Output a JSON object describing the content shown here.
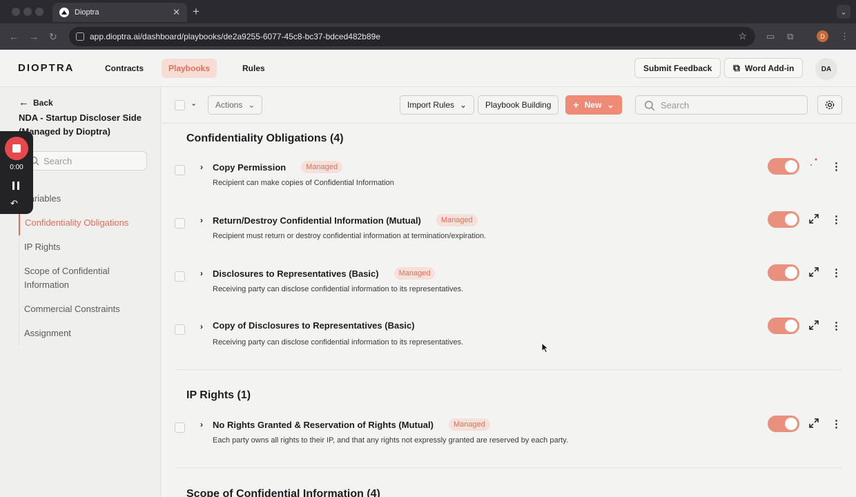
{
  "browser": {
    "tab_title": "Dioptra",
    "url": "app.dioptra.ai/dashboard/playbooks/de2a9255-6077-45c8-bc37-bdced482b89e",
    "profile_initial": "D"
  },
  "nav": {
    "logo": "DIOPTRA",
    "links": [
      "Contracts",
      "Playbooks",
      "Rules"
    ],
    "active": "Playbooks",
    "submit_feedback": "Submit Feedback",
    "word_addin": "Word Add-in",
    "avatar": "DA"
  },
  "sidebar": {
    "back": "Back",
    "title": "NDA - Startup Discloser Side (Managed by Dioptra)",
    "search_placeholder": "Search",
    "items": [
      "Variables",
      "Confidentiality Obligations",
      "IP Rights",
      "Scope of Confidential Information",
      "Commercial Constraints",
      "Assignment"
    ],
    "active": "Confidentiality Obligations"
  },
  "recorder": {
    "time": "0:00"
  },
  "toolbar": {
    "actions": "Actions",
    "import_rules": "Import Rules",
    "playbook_building": "Playbook Building",
    "new": "New",
    "search_placeholder": "Search"
  },
  "sections": [
    {
      "title": "Confidentiality Obligations (4)",
      "rules": [
        {
          "name": "Copy Permission",
          "badge": "Managed",
          "desc": "Recipient can make copies of Confidential Information"
        },
        {
          "name": "Return/Destroy Confidential Information (Mutual)",
          "badge": "Managed",
          "desc": "Recipient must return or destroy confidential information at termination/expiration."
        },
        {
          "name": "Disclosures to Representatives (Basic)",
          "badge": "Managed",
          "desc": "Receiving party can disclose confidential information to its representatives."
        },
        {
          "name": "Copy of Disclosures to Representatives (Basic)",
          "badge": "",
          "desc": "Receiving party can disclose confidential information to its representatives."
        }
      ]
    },
    {
      "title": "IP Rights (1)",
      "rules": [
        {
          "name": "No Rights Granted & Reservation of Rights (Mutual)",
          "badge": "Managed",
          "desc": "Each party owns all rights to their IP, and that any rights not expressly granted are reserved by each party."
        }
      ]
    },
    {
      "title": "Scope of Confidential Information (4)",
      "rules": []
    }
  ],
  "colors": {
    "accent": "#e0705a",
    "toggle_on": "#e9917e",
    "badge_bg": "#f6e0da"
  }
}
